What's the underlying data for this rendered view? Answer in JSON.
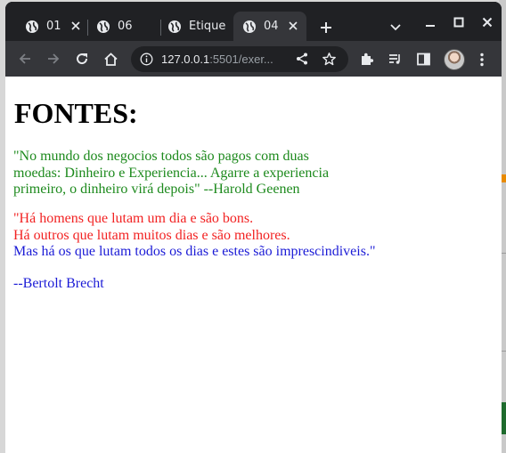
{
  "browser": {
    "tabs": [
      {
        "title": "01",
        "active": false
      },
      {
        "title": "06",
        "active": false
      },
      {
        "title": "Etique",
        "active": false
      },
      {
        "title": "04",
        "active": true
      }
    ],
    "address": {
      "host": "127.0.0.1",
      "path": ":5501/exer..."
    },
    "colors": {
      "frame": "#202124",
      "toolbar": "#35363a",
      "text": "#e8eaed"
    }
  },
  "page": {
    "heading": "FONTES:",
    "quote1": {
      "lines": [
        "\"No mundo dos negocios todos são pagos com duas",
        "moedas: Dinheiro e Experiencia... Agarre a experiencia",
        "primeiro, o dinheiro virá depois\" --Harold Geenen"
      ],
      "color": "#1d8a1d"
    },
    "quote2": {
      "line1": "\"Há homens que lutam um dia e são bons.",
      "line2": "Há outros que lutam muitos dias e são melhores.",
      "line3": "Mas há os que lutam todos os dias e estes são imprescindiveis.\"",
      "author": "--Bertolt Brecht",
      "color_red": "#f22222",
      "color_blue": "#1b1bd6"
    }
  }
}
